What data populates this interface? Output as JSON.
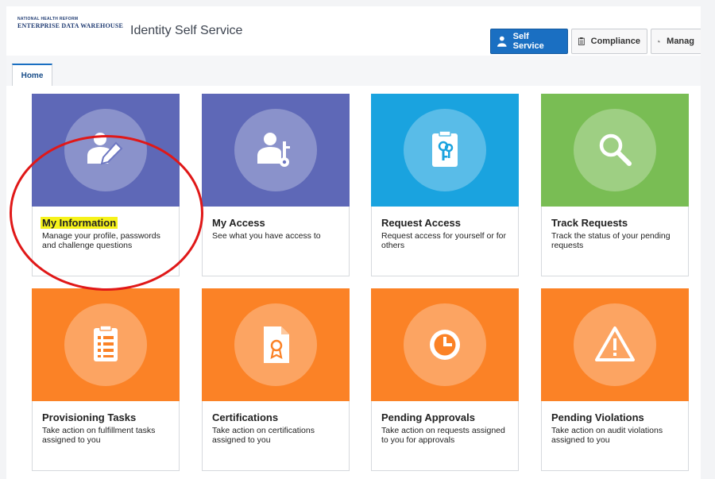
{
  "header": {
    "logo_line1": "NATIONAL HEALTH REFORM",
    "logo_line2": "ENTERPRISE DATA WAREHOUSE",
    "app_title": "Identity Self Service",
    "buttons": [
      {
        "label": "Self Service",
        "icon": "person-icon",
        "active": true
      },
      {
        "label": "Compliance",
        "icon": "clipboard-icon",
        "active": false
      },
      {
        "label": "Manag",
        "icon": "manage-users-icon",
        "active": false
      }
    ]
  },
  "tabs": [
    {
      "label": "Home"
    }
  ],
  "colors": {
    "purple": "#5e68b7",
    "blue": "#1aa3df",
    "green": "#79bd54",
    "orange": "#fb8226",
    "accent": "#1a6fc2",
    "highlight": "#f6f21a",
    "annotation": "#e01818"
  },
  "cards": [
    {
      "title": "My Information",
      "desc": "Manage your profile, passwords and challenge questions",
      "color": "purple",
      "icon": "user-edit-icon",
      "highlighted": true
    },
    {
      "title": "My Access",
      "desc": "See what you have access to",
      "color": "purple",
      "icon": "user-key-icon"
    },
    {
      "title": "Request Access",
      "desc": "Request access for yourself or for others",
      "color": "blue",
      "icon": "key-card-icon"
    },
    {
      "title": "Track Requests",
      "desc": "Track the status of your pending requests",
      "color": "green",
      "icon": "magnifier-icon"
    },
    {
      "title": "Provisioning Tasks",
      "desc": "Take action on fulfillment tasks assigned to you",
      "color": "orange",
      "icon": "task-list-icon"
    },
    {
      "title": "Certifications",
      "desc": "Take action on certifications assigned to you",
      "color": "orange",
      "icon": "certificate-icon"
    },
    {
      "title": "Pending Approvals",
      "desc": "Take action on requests assigned to you for approvals",
      "color": "orange",
      "icon": "clock-icon"
    },
    {
      "title": "Pending Violations",
      "desc": "Take action on audit violations assigned to you",
      "color": "orange",
      "icon": "warning-icon"
    }
  ]
}
